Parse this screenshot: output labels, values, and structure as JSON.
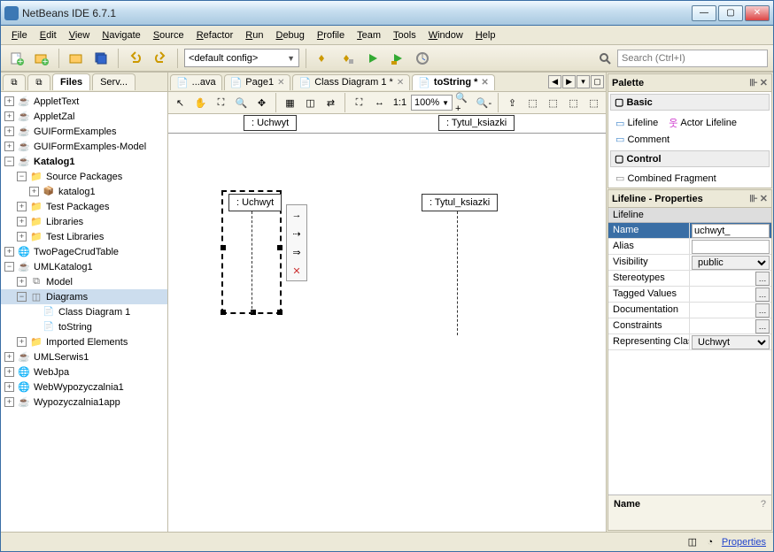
{
  "window": {
    "title": "NetBeans IDE 6.7.1"
  },
  "menu": [
    "File",
    "Edit",
    "View",
    "Navigate",
    "Source",
    "Refactor",
    "Run",
    "Debug",
    "Profile",
    "Team",
    "Tools",
    "Window",
    "Help"
  ],
  "toolbar": {
    "config": "<default config>",
    "search_placeholder": "Search (Ctrl+I)"
  },
  "left": {
    "tabs": [
      "Files",
      "Serv..."
    ],
    "tree": [
      {
        "d": 0,
        "exp": "+",
        "icon": "coffee",
        "label": "AppletText"
      },
      {
        "d": 0,
        "exp": "+",
        "icon": "coffee",
        "label": "AppletZal"
      },
      {
        "d": 0,
        "exp": "+",
        "icon": "coffee",
        "label": "GUIFormExamples"
      },
      {
        "d": 0,
        "exp": "+",
        "icon": "coffee",
        "label": "GUIFormExamples-Model"
      },
      {
        "d": 0,
        "exp": "-",
        "icon": "coffee",
        "label": "Katalog1",
        "bold": true
      },
      {
        "d": 1,
        "exp": "-",
        "icon": "folder",
        "label": "Source Packages"
      },
      {
        "d": 2,
        "exp": "+",
        "icon": "pkg",
        "label": "katalog1"
      },
      {
        "d": 1,
        "exp": "+",
        "icon": "folder",
        "label": "Test Packages"
      },
      {
        "d": 1,
        "exp": "+",
        "icon": "folder",
        "label": "Libraries"
      },
      {
        "d": 1,
        "exp": "+",
        "icon": "folder",
        "label": "Test Libraries"
      },
      {
        "d": 0,
        "exp": "+",
        "icon": "globe",
        "label": "TwoPageCrudTable"
      },
      {
        "d": 0,
        "exp": "-",
        "icon": "coffee",
        "label": "UMLKatalog1"
      },
      {
        "d": 1,
        "exp": "+",
        "icon": "model",
        "label": "Model"
      },
      {
        "d": 1,
        "exp": "-",
        "icon": "diag",
        "label": "Diagrams",
        "selected": true
      },
      {
        "d": 2,
        "exp": "",
        "icon": "doc",
        "label": "Class Diagram 1"
      },
      {
        "d": 2,
        "exp": "",
        "icon": "doc",
        "label": "toString"
      },
      {
        "d": 1,
        "exp": "+",
        "icon": "folder",
        "label": "Imported Elements"
      },
      {
        "d": 0,
        "exp": "+",
        "icon": "coffee",
        "label": "UMLSerwis1"
      },
      {
        "d": 0,
        "exp": "+",
        "icon": "globe",
        "label": "WebJpa"
      },
      {
        "d": 0,
        "exp": "+",
        "icon": "globe",
        "label": "WebWypozyczalnia1"
      },
      {
        "d": 0,
        "exp": "+",
        "icon": "coffee",
        "label": "Wypozyczalnia1app"
      }
    ]
  },
  "editor": {
    "tabs": [
      {
        "label": "...ava",
        "active": false
      },
      {
        "label": "Page1",
        "active": false,
        "close": true
      },
      {
        "label": "Class Diagram 1 *",
        "active": false,
        "close": true
      },
      {
        "label": "toString *",
        "active": true,
        "close": true
      }
    ],
    "zoom": "100%",
    "lane1": ": Uchwyt",
    "lane2": ": Tytul_ksiazki",
    "lifeline1": ": Uchwyt",
    "lifeline2": ": Tytul_ksiazki"
  },
  "palette": {
    "title": "Palette",
    "cat1": "Basic",
    "items1": [
      {
        "label": "Lifeline"
      },
      {
        "label": "Actor Lifeline"
      },
      {
        "label": "Comment"
      }
    ],
    "cat2": "Control",
    "items2": [
      {
        "label": "Combined Fragment"
      }
    ]
  },
  "props": {
    "title": "Lifeline - Properties",
    "cat": "Lifeline",
    "rows": [
      {
        "k": "Name",
        "v": "uchwyt_",
        "sel": true,
        "type": "text"
      },
      {
        "k": "Alias",
        "v": "",
        "type": "text"
      },
      {
        "k": "Visibility",
        "v": "public",
        "type": "select"
      },
      {
        "k": "Stereotypes",
        "v": "",
        "type": "elips"
      },
      {
        "k": "Tagged Values",
        "v": "",
        "type": "elips"
      },
      {
        "k": "Documentation",
        "v": "",
        "type": "elips"
      },
      {
        "k": "Constraints",
        "v": "",
        "type": "elips"
      },
      {
        "k": "Representing Clas",
        "v": "Uchwyt",
        "type": "select"
      }
    ],
    "desc": "Name"
  },
  "footer_link": "Properties"
}
